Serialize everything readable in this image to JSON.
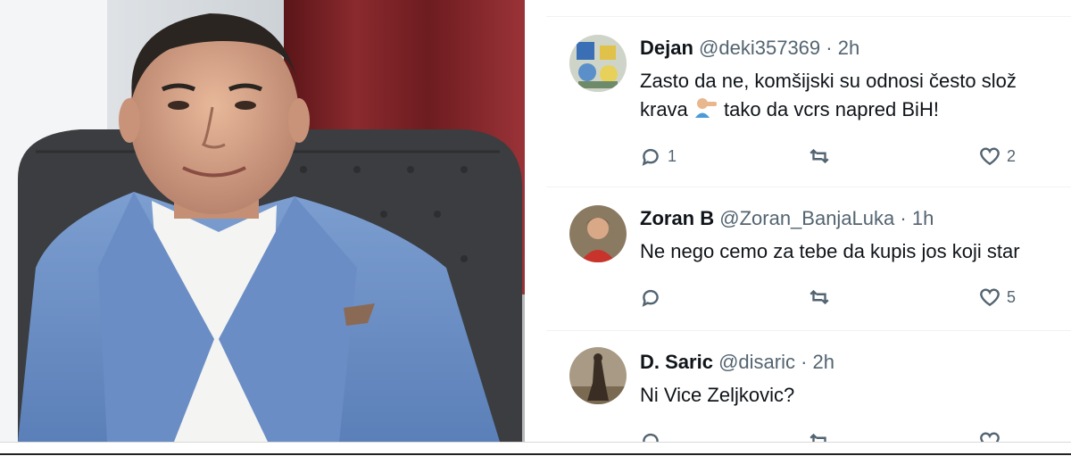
{
  "tweets": [
    {
      "name": "Dejan",
      "handle": "@deki357369",
      "time": "· 2h",
      "text_line1": "Zasto da ne, komšijski su odnosi često slož",
      "text_line2_a": "krava",
      "text_line2_b": "tako da vcrs napred BiH!",
      "reply_count": "1",
      "like_count": "2"
    },
    {
      "name": "Zoran B",
      "handle": "@Zoran_BanjaLuka",
      "time": "· 1h",
      "text_line1": "Ne nego cemo za tebe da kupis jos koji star",
      "reply_count": "",
      "like_count": "5"
    },
    {
      "name": "D. Saric",
      "handle": "@disaric",
      "time": "· 2h",
      "text_line1": "Ni Vice Zeljkovic?"
    }
  ],
  "icons": [
    "reply-icon",
    "retweet-icon",
    "like-icon"
  ],
  "colors": {
    "text": "#0f1419",
    "secondary": "#536471",
    "divider": "#eff3f4"
  }
}
